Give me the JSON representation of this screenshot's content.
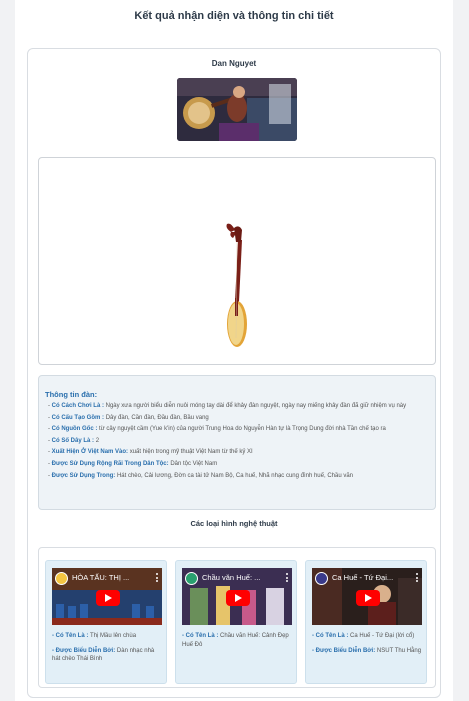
{
  "page": {
    "title": "Kết quả nhận diện và thông tin chi tiết"
  },
  "instrument": {
    "name": "Dan Nguyet"
  },
  "info": {
    "title": "Thông tin đàn:",
    "items": [
      {
        "key": "Có Cách Chơi Là",
        "value": "Ngày xưa người biểu diễn nuôi móng tay dài để khảy đàn nguyệt, ngày nay miếng khảy đàn đã giữ nhiệm vụ này"
      },
      {
        "key": "Có Cấu Tạo Gồm",
        "value": "Dây đàn, Cần đàn, Đầu đàn, Bầu vang"
      },
      {
        "key": "Có Nguồn Gốc",
        "value": "từ cây nguyệt cầm (Yue k'in) của người Trung Hoa do Nguyễn Hàn tự là Trọng Dung đời nhà Tần chế tạo ra"
      },
      {
        "key": "Có Số Dây Là",
        "value": "2"
      },
      {
        "key": "Xuất Hiện Ở Việt Nam Vào",
        "value": "xuất hiện trong mỹ thuật Việt Nam từ thế kỷ XI"
      },
      {
        "key": "Được Sử Dụng Rộng Rãi Trong Dân Tộc",
        "value": "Dân tộc Việt Nam"
      },
      {
        "key": "Được Sử Dụng Trong",
        "value": "Hát chèo, Cải lương, Đờn ca tài tử Nam Bộ, Ca huế, Nhã nhạc cung đình huế, Chầu văn"
      }
    ]
  },
  "performances": {
    "title": "Các loại hình nghệ thuật",
    "name_key": "Có Tên Là",
    "performer_key": "Được Biểu Diễn Bởi",
    "items": [
      {
        "video_title": "HÒA TẤU: THỊ ...",
        "name": "Thị Mầu lên chùa",
        "performer": "Dàn nhạc nhà hát chèo Thái Bình"
      },
      {
        "video_title": "Chầu văn Huế: ...",
        "name": "Chầu văn Huế: Cảnh Đẹp Huế Đô",
        "performer": ""
      },
      {
        "video_title": "Ca Huế - Tứ Đại...",
        "name": "Ca Huế - Tứ Đại (lời cổ)",
        "performer": "NSUT Thu Hằng"
      }
    ]
  },
  "colors": {
    "accent": "#2a6fad",
    "play_button": "#ff0000",
    "card_bg": "#e2eff7",
    "wood": "#7a1f18",
    "drum_face": "#f1d58a"
  }
}
